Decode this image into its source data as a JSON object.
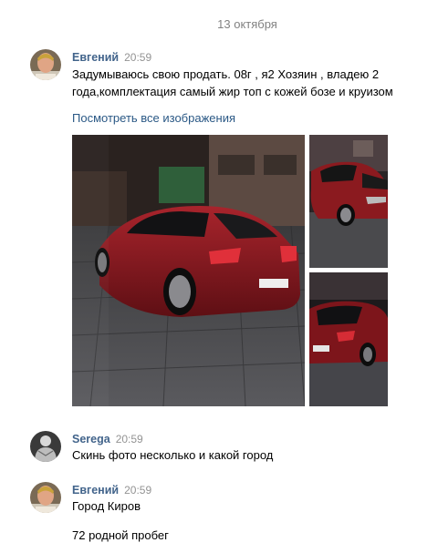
{
  "date_separator": "13 октября",
  "messages": [
    {
      "author": "Евгений",
      "time": "20:59",
      "text_lines": [
        "Задумываюсь свою продать. 08г , я2 Хозяин , владею 2",
        "года,комплектация самый жир топ с кожей бозе и круизом"
      ],
      "link": "Посмотреть все изображения"
    },
    {
      "author": "Serega",
      "time": "20:59",
      "text_lines": [
        "Скинь фото несколько и какой город"
      ]
    },
    {
      "author": "Евгений",
      "time": "20:59",
      "text_lines": [
        "Город Киров",
        "72 родной пробег"
      ]
    }
  ],
  "colors": {
    "author_link": "#42648b",
    "link": "#2a5885",
    "time": "#939393",
    "date": "#828282",
    "car_red": "#8b1a1f"
  },
  "photos": [
    "car-rear-photo",
    "car-front-photo",
    "car-rear-small-photo"
  ]
}
